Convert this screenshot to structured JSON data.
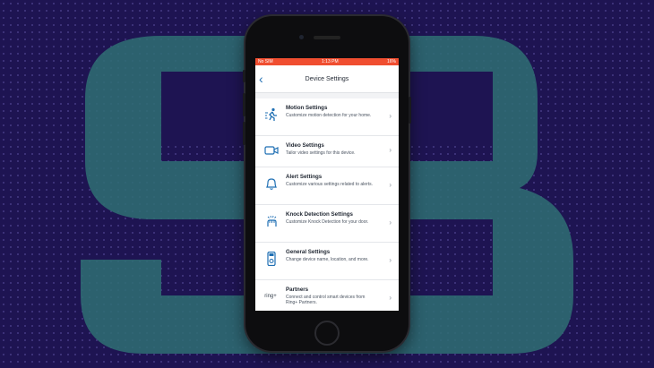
{
  "status_bar": {
    "carrier": "No SIM",
    "time": "1:13 PM",
    "battery": "16%"
  },
  "header": {
    "title": "Device Settings"
  },
  "settings": [
    {
      "icon": "motion-icon",
      "title": "Motion Settings",
      "description": "Customize motion detection for your home."
    },
    {
      "icon": "video-camera-icon",
      "title": "Video Settings",
      "description": "Tailor video settings for this device."
    },
    {
      "icon": "bell-icon",
      "title": "Alert Settings",
      "description": "Customize various settings related to alerts."
    },
    {
      "icon": "knock-icon",
      "title": "Knock Detection Settings",
      "description": "Customize Knock Detection for your door."
    },
    {
      "icon": "doorbell-device-icon",
      "title": "General Settings",
      "description": "Change device name, location, and more."
    },
    {
      "icon": "ring-plus-logo",
      "title": "Partners",
      "description": "Connect and control smart devices from Ring+ Partners.",
      "logo_text": "ring+"
    }
  ],
  "colors": {
    "background": "#1e1452",
    "logo": "#2f6f73",
    "status_bar": "#f04e30",
    "accent": "#1f6fb3"
  }
}
